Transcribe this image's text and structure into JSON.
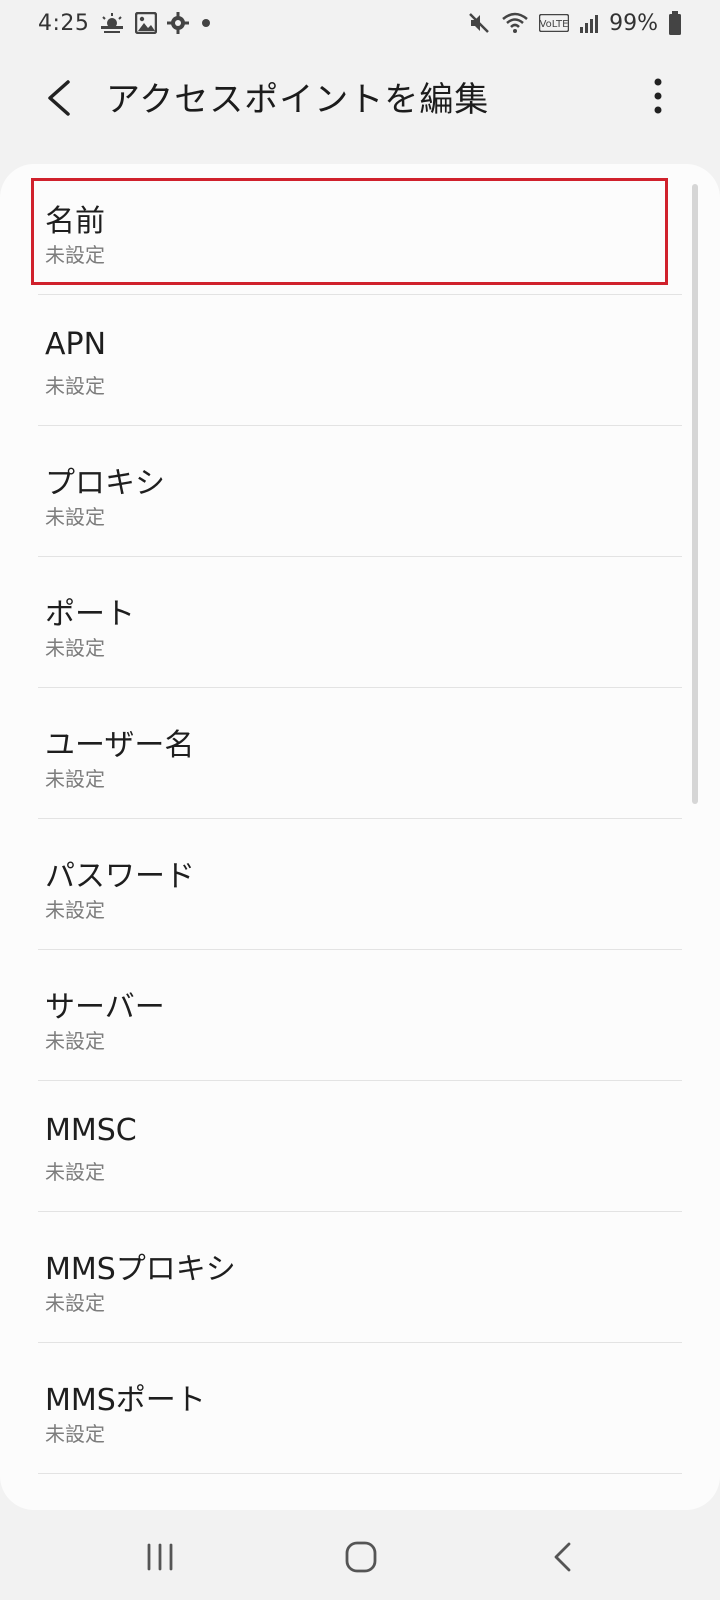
{
  "status_bar": {
    "time": "4:25",
    "battery_percent": "99%",
    "left_icons": [
      "weather-icon",
      "image-icon",
      "gear-icon",
      "dot-icon"
    ],
    "right_icons": [
      "mute-icon",
      "wifi-icon",
      "volte-icon",
      "signal-icon",
      "battery-icon"
    ],
    "volte_label": "VoLTE"
  },
  "app_bar": {
    "title": "アクセスポイントを編集"
  },
  "settings": [
    {
      "title": "名前",
      "value": "未設定"
    },
    {
      "title": "APN",
      "value": "未設定"
    },
    {
      "title": "プロキシ",
      "value": "未設定"
    },
    {
      "title": "ポート",
      "value": "未設定"
    },
    {
      "title": "ユーザー名",
      "value": "未設定"
    },
    {
      "title": "パスワード",
      "value": "未設定"
    },
    {
      "title": "サーバー",
      "value": "未設定"
    },
    {
      "title": "MMSC",
      "value": "未設定"
    },
    {
      "title": "MMSプロキシ",
      "value": "未設定"
    },
    {
      "title": "MMSポート",
      "value": "未設定"
    }
  ],
  "colors": {
    "highlight": "#d0212c",
    "background": "#f2f2f2",
    "card": "#fcfcfc"
  }
}
